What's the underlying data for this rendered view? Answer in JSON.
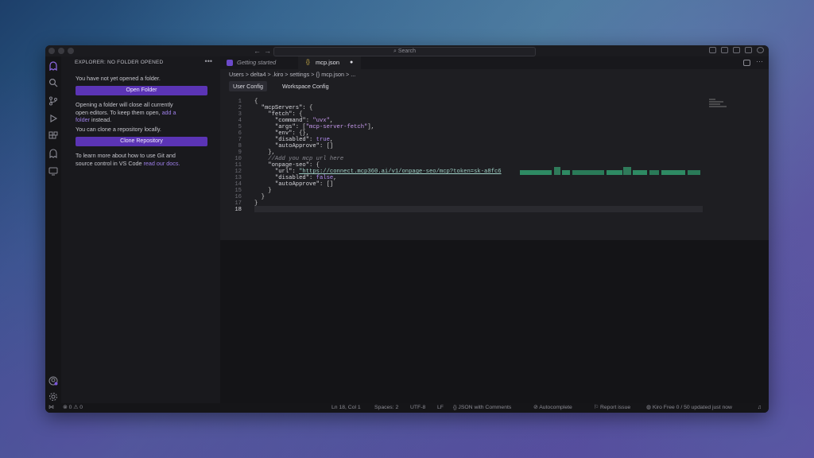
{
  "titlebar": {
    "search_label": "⌕ Search",
    "back_glyph": "←",
    "forward_glyph": "→"
  },
  "sidebar": {
    "title": "EXPLORER: NO FOLDER OPENED",
    "more": "•••",
    "no_folder_text": "You have not yet opened a folder.",
    "open_folder_label": "Open Folder",
    "open_folder_note_1": "Opening a folder will close all currently",
    "open_folder_note_2": "open editors. To keep them open,",
    "add_a_label": "add a",
    "folder_label": "folder",
    "instead_label": "instead.",
    "clone_text": "You can clone a repository locally.",
    "clone_label": "Clone Repository",
    "git_text_1": "To learn more about how to use Git and",
    "git_text_2": "source control in VS Code",
    "read_docs_label": "read our docs."
  },
  "tabs": [
    {
      "label": "Getting started",
      "icon": "kiro-icon"
    },
    {
      "label": "mcp.json",
      "icon": "braces-icon",
      "dirty": "●"
    }
  ],
  "breadcrumb": "Users > delta4 > .kiro > settings > {} mcp.json > ...",
  "config_tabs": [
    "User Config",
    "Workspace Config"
  ],
  "code": {
    "line_numbers": [
      "1",
      "2",
      "3",
      "4",
      "5",
      "6",
      "7",
      "8",
      "9",
      "10",
      "11",
      "12",
      "13",
      "14",
      "15",
      "16",
      "17",
      "18"
    ],
    "l1": "{",
    "l2_key": "  \"mcpServers\"",
    "l2_rest": ": {",
    "l3_key": "    \"fetch\"",
    "l3_rest": ": {",
    "l4_key": "      \"command\"",
    "l4_sep": ": ",
    "l4_val": "\"uvx\"",
    "l4_end": ",",
    "l5_key": "      \"args\"",
    "l5_sep": ": [",
    "l5_val": "\"mcp-server-fetch\"",
    "l5_end": "],",
    "l6_key": "      \"env\"",
    "l6_rest": ": {},",
    "l7_key": "      \"disabled\"",
    "l7_sep": ": ",
    "l7_val": "true",
    "l7_end": ",",
    "l8_key": "      \"autoApprove\"",
    "l8_rest": ": []",
    "l9": "    },",
    "l10": "    //Add you mcp url here",
    "l11_key": "    \"onpage-seo\"",
    "l11_rest": ": {",
    "l12_key": "      \"url\"",
    "l12_sep": ": ",
    "l12_val": "\"https://connect.mcp360.ai/v1/onpage-seo/mcp?token=sk-a8fc6",
    "l13_key": "      \"disabled\"",
    "l13_sep": ": ",
    "l13_val": "false",
    "l13_end": ",",
    "l14_key": "      \"autoApprove\"",
    "l14_rest": ": []",
    "l15": "    }",
    "l16": "  }",
    "l17": "}",
    "l18": ""
  },
  "statusbar": {
    "errors": "⊗ 0 ⚠ 0",
    "position": "Ln 18, Col 1",
    "spaces": "Spaces: 2",
    "encoding": "UTF-8",
    "eol": "LF",
    "language": "{} JSON with Comments",
    "autocomplete": "Autocomplete",
    "report": "Report issue",
    "plan": "Kiro Free 0 / 50 updated just now"
  },
  "colors": {
    "accent": "#5b34b5",
    "link": "#9d7ee8",
    "redaction": "#2e8a63"
  }
}
